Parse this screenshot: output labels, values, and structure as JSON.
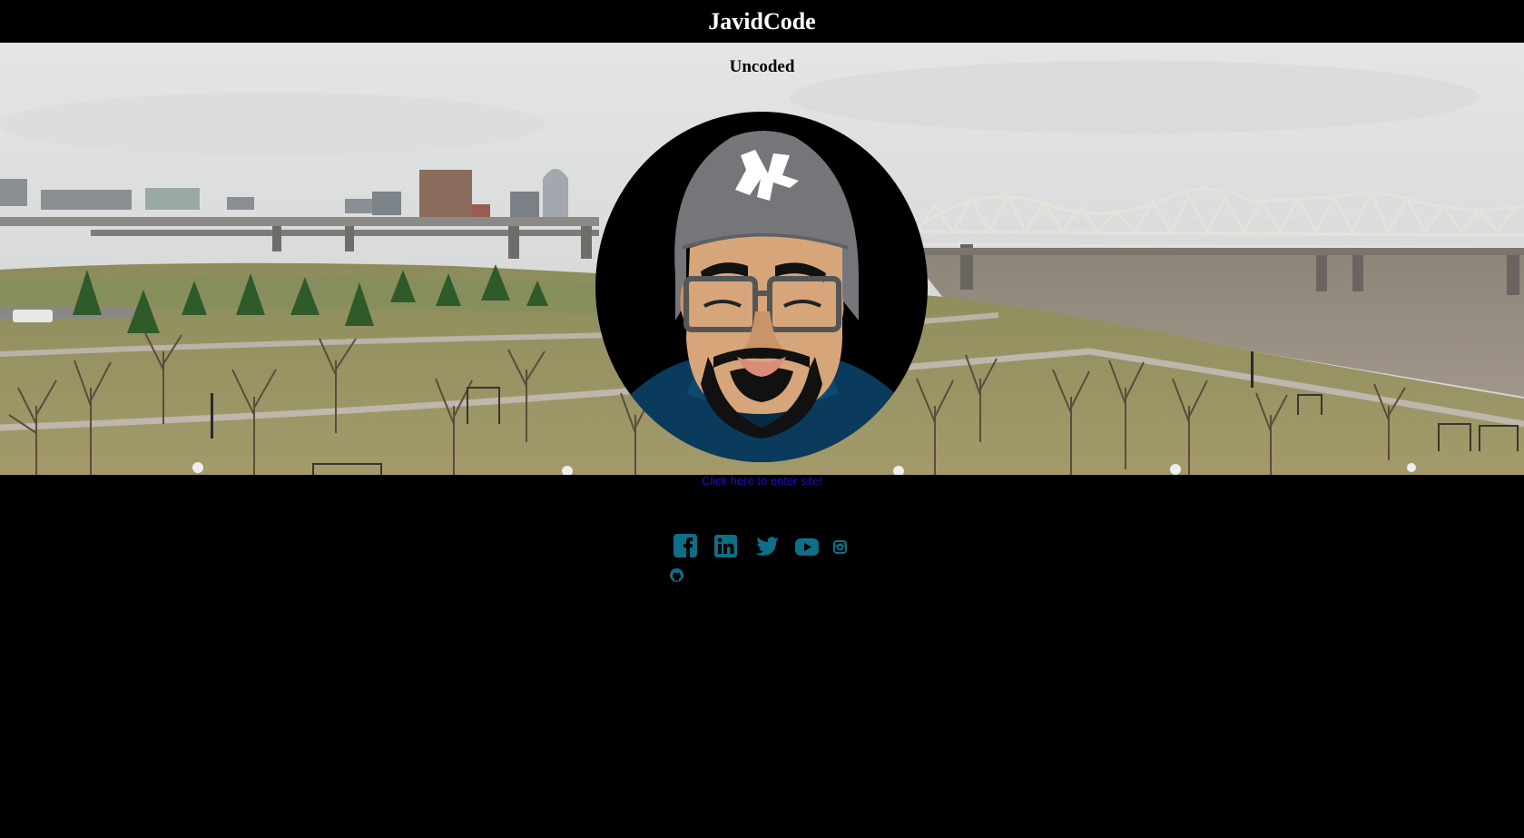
{
  "header": {
    "title": "JavidCode"
  },
  "hero": {
    "subtitle": "Uncoded",
    "background": "city-skyline-river-park-photo",
    "avatar": "bearded-man-avatar-illustration"
  },
  "enter_link": {
    "label": "Click here to enter site!"
  },
  "social": {
    "color": "#0e6f86",
    "items": [
      {
        "icon": "facebook-icon"
      },
      {
        "icon": "linkedin-icon"
      },
      {
        "icon": "twitter-icon"
      },
      {
        "icon": "youtube-icon"
      },
      {
        "icon": "instagram-icon"
      },
      {
        "icon": "github-icon"
      }
    ]
  },
  "colors": {
    "background": "#000000",
    "title": "#ffffff",
    "link": "#1a0dcc",
    "social": "#0e6f86"
  }
}
